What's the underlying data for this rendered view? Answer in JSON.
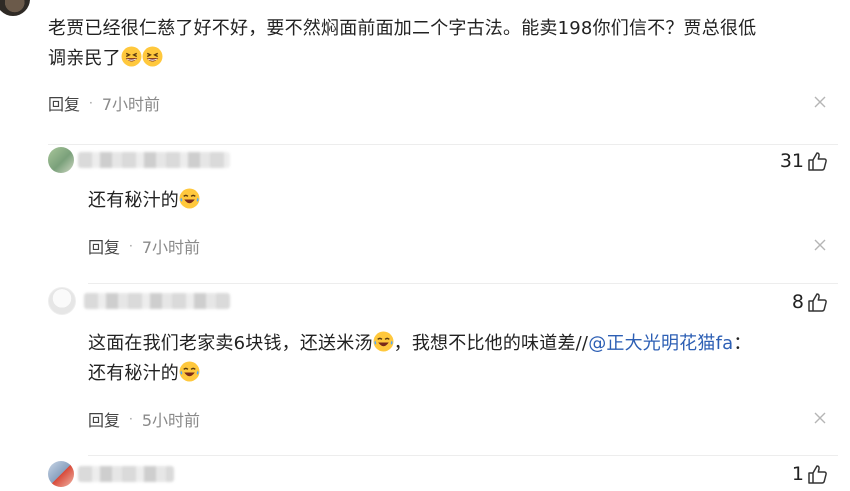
{
  "top_comment": {
    "line1": "老贾已经很仁慈了好不好，要不然焖面前面加二个字古法。能卖198你们信不？贾总很低",
    "line2": "调亲民了",
    "reply_label": "回复",
    "time": "7小时前",
    "emojis": [
      "grinning-squint-emoji",
      "grinning-squint-emoji"
    ]
  },
  "replies": [
    {
      "likes": "31",
      "text": "还有秘汁的",
      "emoji": "laughing-tears-emoji",
      "reply_label": "回复",
      "time": "7小时前"
    },
    {
      "likes": "8",
      "text_part1": "这面在我们老家卖6块钱，还送米汤",
      "emoji": "laughing-tears-emoji",
      "text_part2": "，我想不比他的味道差//",
      "mention": "@正大光明花猫fa",
      "text_part3": "：",
      "line2": "还有秘汁的",
      "reply_label": "回复",
      "time": "5小时前"
    },
    {
      "likes": "1"
    }
  ],
  "colors": {
    "mention": "#2d5fb4",
    "meta_gray": "#8a8a8a",
    "divider": "#ededed"
  }
}
